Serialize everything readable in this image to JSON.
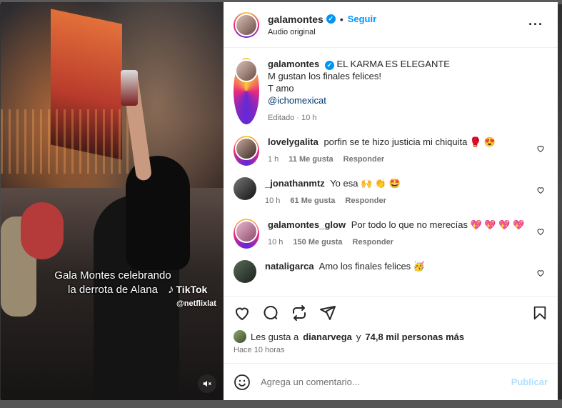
{
  "media": {
    "caption_line1": "Gala Montes celebrando",
    "caption_line2": "la derrota de Alana",
    "watermark": "TikTok",
    "watermark_handle": "@netflixlat",
    "mute_icon": "speaker-muted-icon"
  },
  "header": {
    "username": "galamontes",
    "separator": "•",
    "follow_label": "Seguir",
    "audio_label": "Audio original",
    "more_icon": "more-horizontal-icon"
  },
  "caption": {
    "username": "galamontes",
    "line1": "EL KARMA ES ELEGANTE",
    "line2": "M gustan los finales felices!",
    "line3": "T amo",
    "mention": "@ichomexicat",
    "meta": "Editado · 10 h"
  },
  "comments": [
    {
      "username": "lovelygalita",
      "text": "porfin se te hizo justicia mi chiquita 🥊 😍",
      "time": "1 h",
      "likes": "11 Me gusta",
      "reply": "Responder"
    },
    {
      "username": "_jonathanmtz",
      "text": "Yo esa 🙌 👏 🤩",
      "time": "10 h",
      "likes": "61 Me gusta",
      "reply": "Responder"
    },
    {
      "username": "galamontes_glow",
      "text": "Por todo lo que no merecías 💖 💖 💖 💖",
      "time": "10 h",
      "likes": "150 Me gusta",
      "reply": "Responder"
    },
    {
      "username": "nataligarca",
      "text": "Amo los finales felices 🥳",
      "time": "",
      "likes": "",
      "reply": ""
    }
  ],
  "likes": {
    "prefix": "Les gusta a",
    "user": "dianarvega",
    "connector": "y",
    "others": "74,8 mil personas más"
  },
  "time_ago": "Hace 10 horas",
  "add_comment": {
    "placeholder": "Agrega un comentario...",
    "publish": "Publicar"
  }
}
